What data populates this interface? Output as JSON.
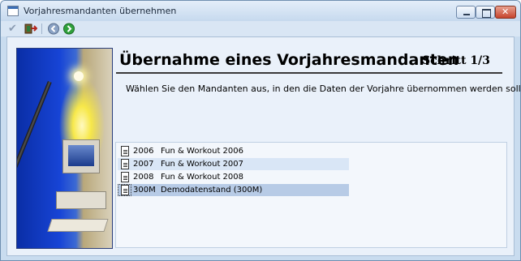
{
  "window": {
    "title": "Vorjahresmandanten übernehmen"
  },
  "toolbar": {
    "items": [
      {
        "name": "check-icon",
        "label": "✔"
      },
      {
        "name": "exit-icon"
      },
      {
        "name": "back-icon"
      },
      {
        "name": "forward-icon"
      }
    ]
  },
  "wizard": {
    "heading": "Übernahme eines Vorjahresmandanten",
    "step": "Schritt 1/3",
    "instruction": "Wählen Sie den Mandanten aus, in den die Daten der Vorjahre übernommen werden sollen."
  },
  "list": {
    "rows": [
      {
        "code": "2006",
        "name": "Fun & Workout 2006",
        "state": "normal"
      },
      {
        "code": "2007",
        "name": "Fun & Workout 2007",
        "state": "hover"
      },
      {
        "code": "2008",
        "name": "Fun & Workout 2008",
        "state": "normal"
      },
      {
        "code": "300M",
        "name": "Demodatenstand (300M)",
        "state": "selected"
      }
    ]
  },
  "colors": {
    "window_bg": "#c9dcef",
    "client_bg": "#eaf1fa",
    "selected_row": "#b7cbe6",
    "hover_row": "#d9e6f6",
    "back_button": "#8aa2c4",
    "forward_button": "#2fa13c"
  }
}
